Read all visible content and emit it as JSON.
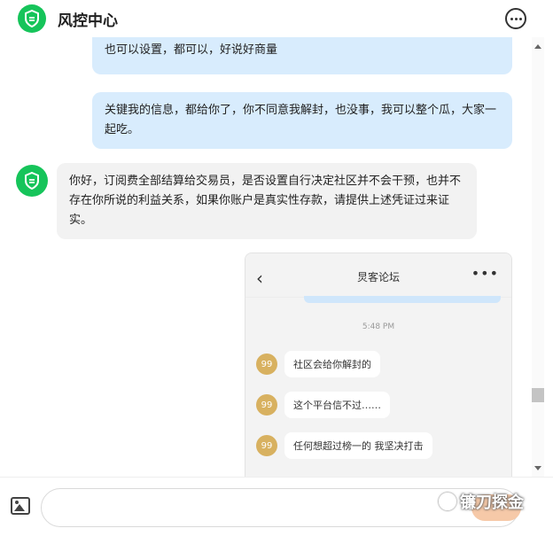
{
  "header": {
    "title": "风控中心",
    "logo_icon": "shield-check-icon",
    "more_icon": "more-horizontal-icon"
  },
  "messages": [
    {
      "role": "user",
      "text": "也可以设置，都可以，好说好商量"
    },
    {
      "role": "user",
      "text": "关键我的信息，都给你了，你不同意我解封，也没事，我可以整个瓜，大家一起吃。"
    },
    {
      "role": "bot",
      "text": "你好，订阅费全部结算给交易员，是否设置自行决定社区并不会干预，也并不存在你所说的利益关系，如果你账户是真实性存款，请提供上述凭证过来证实。"
    }
  ],
  "screenshot": {
    "title": "炅客论坛",
    "time": "5:48 PM",
    "avatar_text": "99",
    "messages": [
      "社区会给你解封的",
      "这个平台信不过……",
      "任何想超过榜一的 我坚决打击"
    ]
  },
  "bottom": {
    "image_icon": "image-icon",
    "input_placeholder": "",
    "watermark": "镰刀探金"
  },
  "colors": {
    "brand_green": "#16c45a",
    "user_bubble": "#d8ecfd",
    "bot_bubble": "#f2f2f2",
    "avatar_gold": "#d8b160"
  }
}
